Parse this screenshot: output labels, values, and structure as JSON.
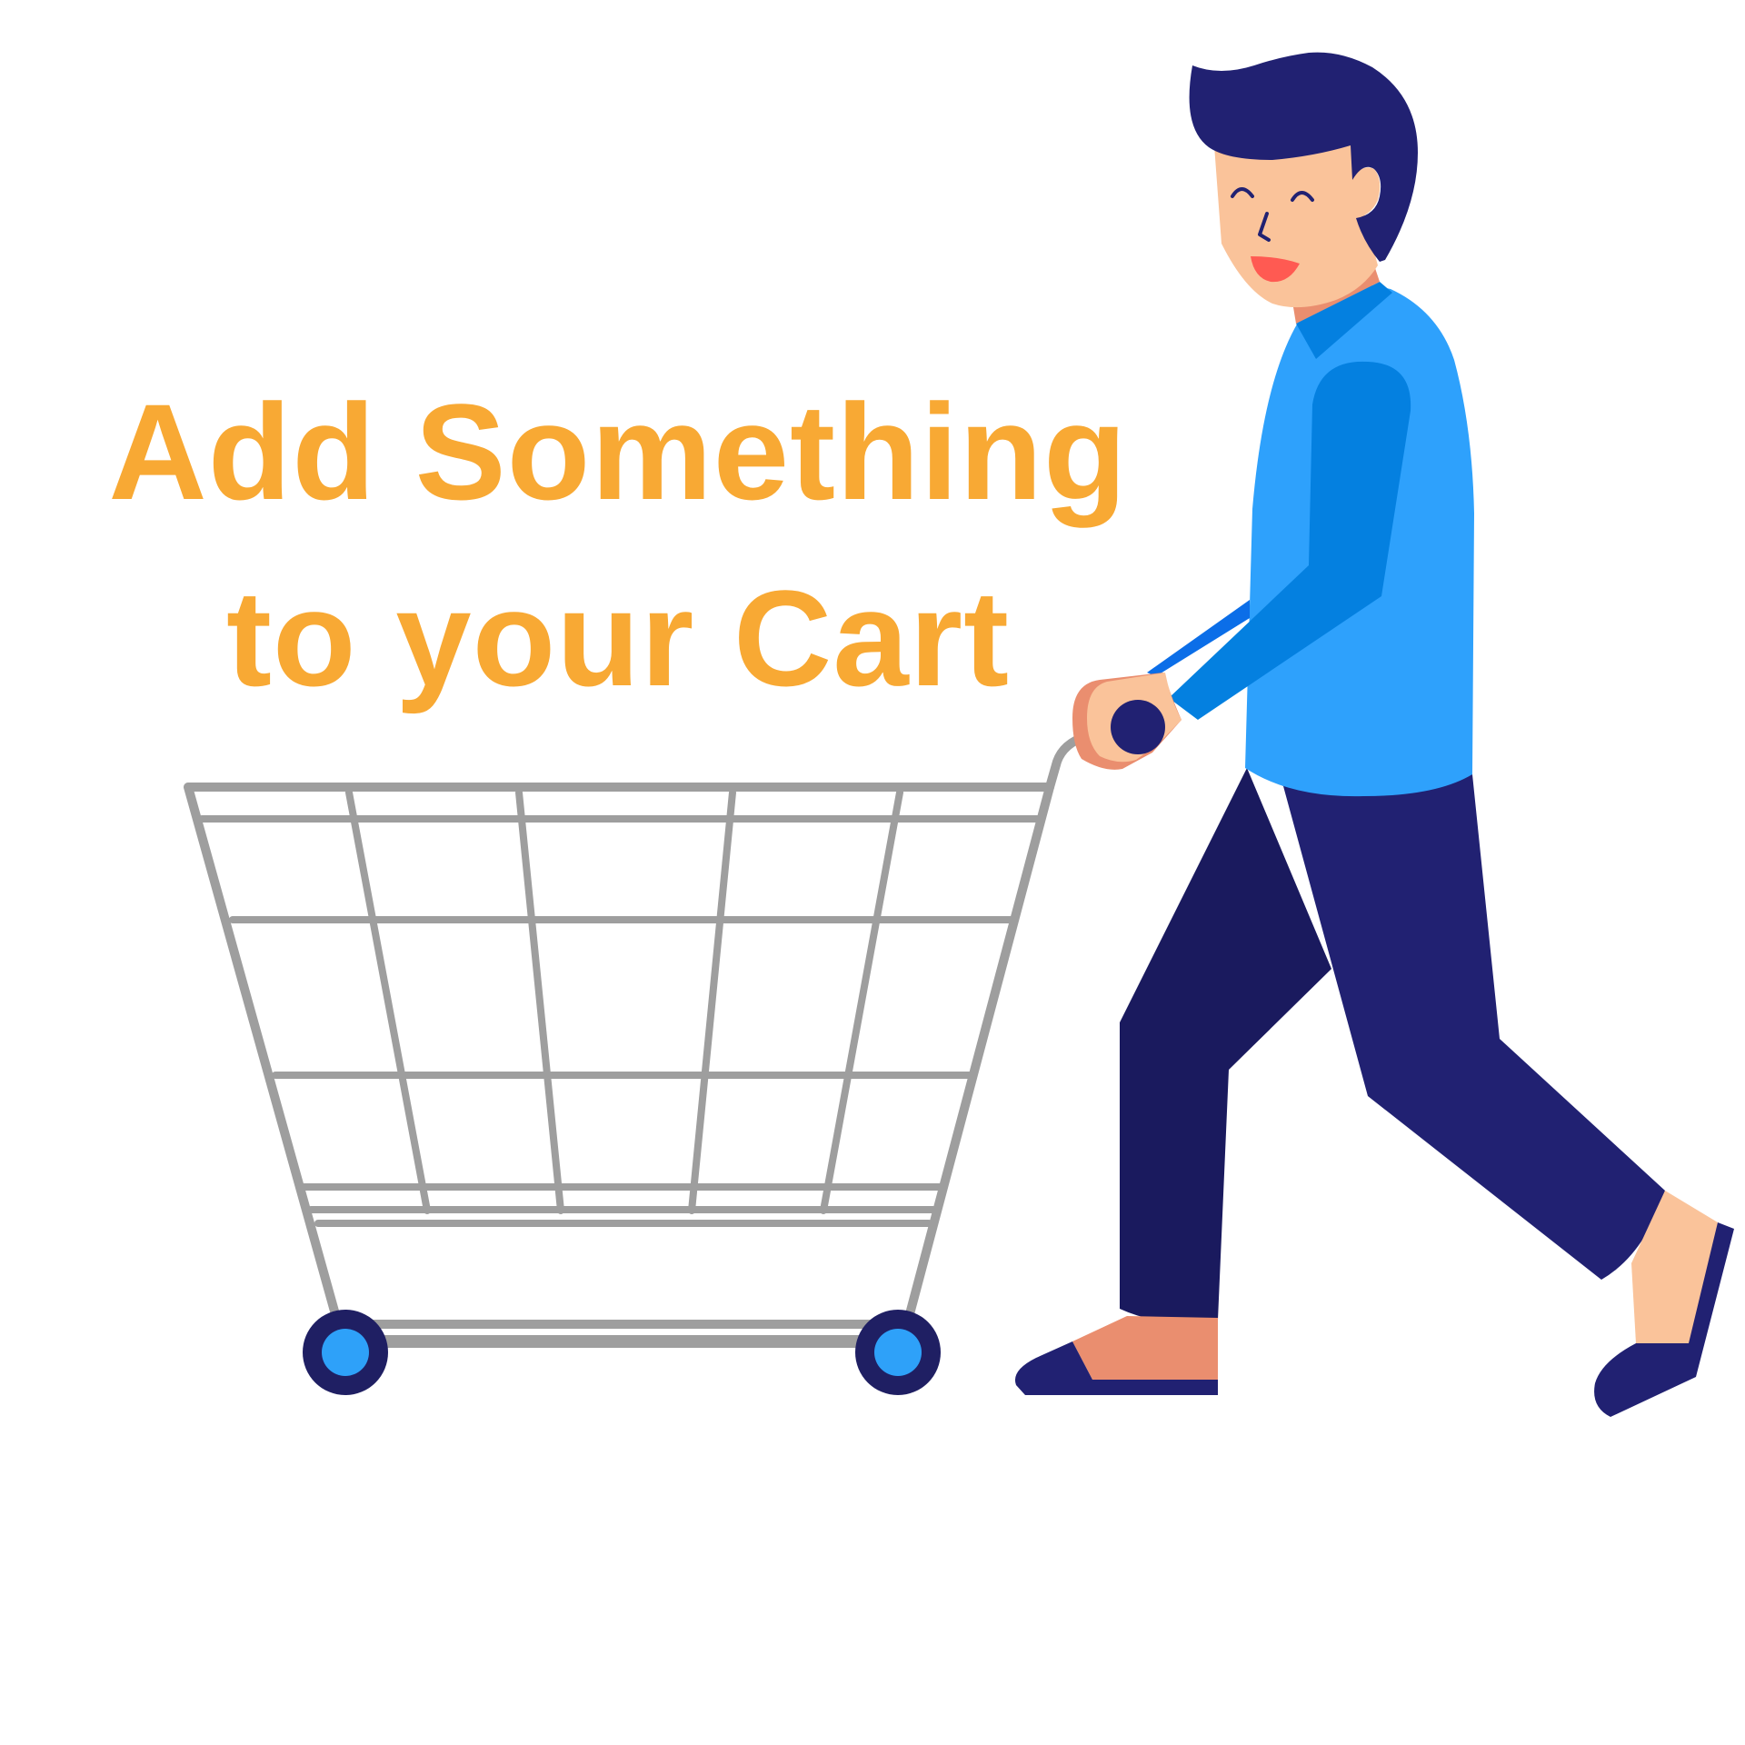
{
  "empty_cart": {
    "line1": "Add Something",
    "line2": "to your Cart"
  },
  "illustration": {
    "subject": "person-pushing-shopping-cart",
    "colors": {
      "heading_orange": "#F8A934",
      "cart_frame_gray": "#9E9E9E",
      "wheel_navy": "#1F1F63",
      "wheel_hub_blue": "#2EA1F9",
      "hair_navy": "#212172",
      "skin": "#FAC39A",
      "skin_shadow": "#EA8E6F",
      "shirt_blue": "#2EA1FC",
      "sleeve_blue": "#0480E0",
      "pants_navy": "#212172",
      "pants_dark": "#1A1A5E",
      "shoe_navy": "#212172",
      "mouth_red": "#FF5A52"
    }
  }
}
